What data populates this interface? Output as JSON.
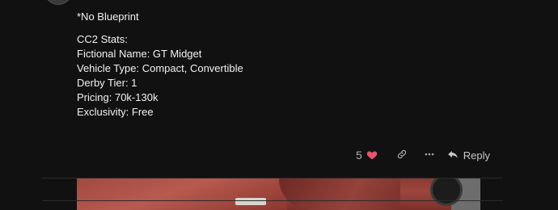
{
  "post": {
    "lines": {
      "blueprint": "*No Blueprint",
      "stats_header": "CC2 Stats:",
      "fictional_name": "Fictional Name: GT Midget",
      "vehicle_type": "Vehicle Type: Compact, Convertible",
      "derby_tier": "Derby Tier: 1",
      "pricing": "Pricing: 70k-130k",
      "exclusivity": "Exclusivity: Free"
    }
  },
  "actions": {
    "like_count": "5",
    "reply_label": "Reply"
  },
  "colors": {
    "background": "#111111",
    "text": "#f2f2f2",
    "heart": "#e8536b",
    "muted": "#a8a8a8"
  },
  "icons": [
    "heart-icon",
    "link-icon",
    "ellipsis-icon",
    "reply-icon"
  ]
}
